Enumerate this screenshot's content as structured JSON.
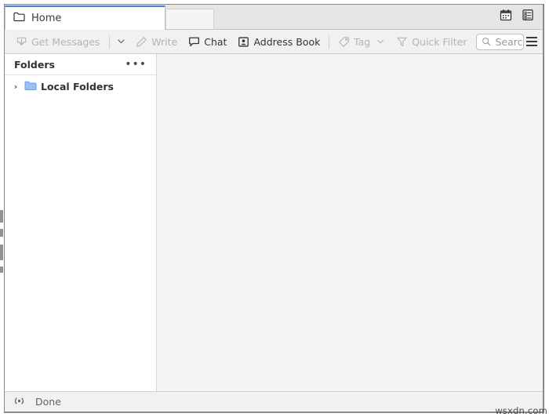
{
  "window": {
    "tabs": [
      {
        "label": "Home",
        "icon": "folder-icon",
        "active": true
      }
    ],
    "tabbar_buttons": [
      {
        "name": "calendar-icon",
        "label": "Calendar"
      },
      {
        "name": "tasks-icon",
        "label": "Tasks"
      }
    ]
  },
  "toolbar": {
    "get_messages_label": "Get Messages",
    "get_messages_icon": "download-inbox-icon",
    "get_messages_dropdown_icon": "chevron-down-icon",
    "write_label": "Write",
    "write_icon": "pencil-icon",
    "chat_label": "Chat",
    "chat_icon": "speech-bubble-icon",
    "address_book_label": "Address Book",
    "address_book_icon": "contact-card-icon",
    "tag_label": "Tag",
    "tag_icon": "tag-icon",
    "tag_dropdown_icon": "chevron-down-icon",
    "quick_filter_label": "Quick Filter",
    "quick_filter_icon": "funnel-icon",
    "menu_icon": "hamburger-menu-icon"
  },
  "search": {
    "placeholder": "Search <Ctrl+K>",
    "value": "",
    "icon": "search-icon"
  },
  "sidebar": {
    "header_title": "Folders",
    "header_more_label": "•••",
    "tree": [
      {
        "label": "Local Folders",
        "icon": "folder-icon",
        "expanded": false,
        "twisty": "›"
      }
    ]
  },
  "statusbar": {
    "icon": "activity-broadcast-icon",
    "text": "Done"
  },
  "watermark": {
    "text": "wsxdn.com"
  },
  "colors": {
    "accent": "#3584e4",
    "folder_blue": "#62a0ea",
    "toolbar_bg": "#f2f1f0",
    "content_bg": "#f6f5f4",
    "disabled_text": "#b6b3b0"
  }
}
